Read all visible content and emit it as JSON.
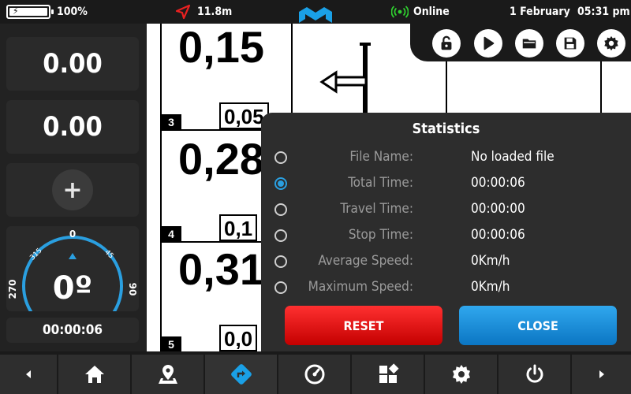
{
  "status": {
    "battery_percent": 100,
    "battery_label": "100%",
    "distance": "11.8m",
    "online": "Online",
    "date": "1 February",
    "time": "05:31 pm"
  },
  "left_panel": {
    "value1": "0.00",
    "value2": "0.00",
    "add_label": "+",
    "compass": {
      "heading": "0º",
      "heading_degrees": 0,
      "north_label": "0",
      "ne_label": "45",
      "nw_label": "315",
      "east_label": "90",
      "west_label": "270"
    },
    "timer": "00:00:06"
  },
  "roadbook": {
    "rows": [
      {
        "number": "",
        "big": "0,15",
        "small": ""
      },
      {
        "number": "3",
        "big": "0,28",
        "small": "0,05"
      },
      {
        "number": "4",
        "big": "0,31",
        "small": "0,1"
      },
      {
        "number": "5",
        "big": "",
        "small": "0,0"
      }
    ]
  },
  "toolbar": {
    "icons": [
      "unlock-icon",
      "play-icon",
      "folder-icon",
      "save-icon",
      "gear-icon"
    ]
  },
  "stats": {
    "title": "Statistics",
    "rows": [
      {
        "label": "File Name:",
        "value": "No loaded file",
        "selected": false
      },
      {
        "label": "Total Time:",
        "value": "00:00:06",
        "selected": true
      },
      {
        "label": "Travel Time:",
        "value": "00:00:00",
        "selected": false
      },
      {
        "label": "Stop Time:",
        "value": "00:00:06",
        "selected": false
      },
      {
        "label": "Average Speed:",
        "value": "0Km/h",
        "selected": false
      },
      {
        "label": "Maximum Speed:",
        "value": "0Km/h",
        "selected": false
      }
    ],
    "reset_label": "RESET",
    "close_label": "CLOSE"
  },
  "colors": {
    "accent_blue": "#2a9fe0",
    "reset_red": "#e01010",
    "online_green": "#2fcf2f",
    "nav_red": "#e82020"
  }
}
